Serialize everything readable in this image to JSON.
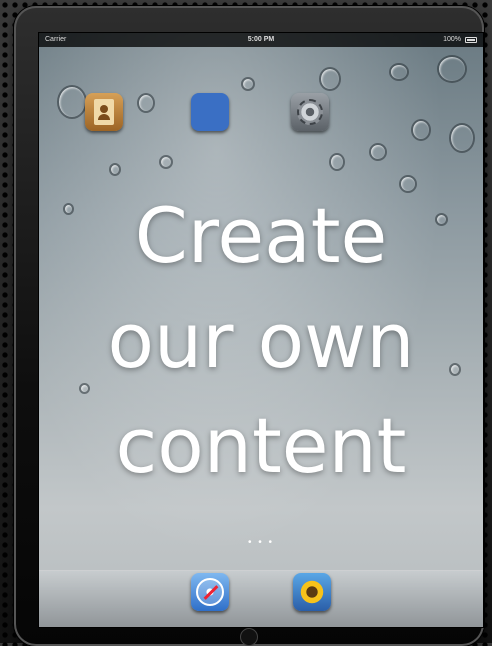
{
  "status_bar": {
    "carrier": "Carrier",
    "time": "5:00 PM",
    "battery": "100%"
  },
  "home_screen": {
    "apps": [
      {
        "icon": "contacts-icon"
      },
      {
        "icon": "game-center-icon"
      },
      {
        "icon": "settings-icon"
      }
    ],
    "page_indicator": "• • •",
    "dock_apps": [
      {
        "icon": "safari-icon",
        "label": "Safari"
      },
      {
        "icon": "photos-icon",
        "label": "Photos"
      }
    ]
  },
  "overlay": {
    "lines": [
      "Create",
      "our own",
      "content"
    ]
  }
}
